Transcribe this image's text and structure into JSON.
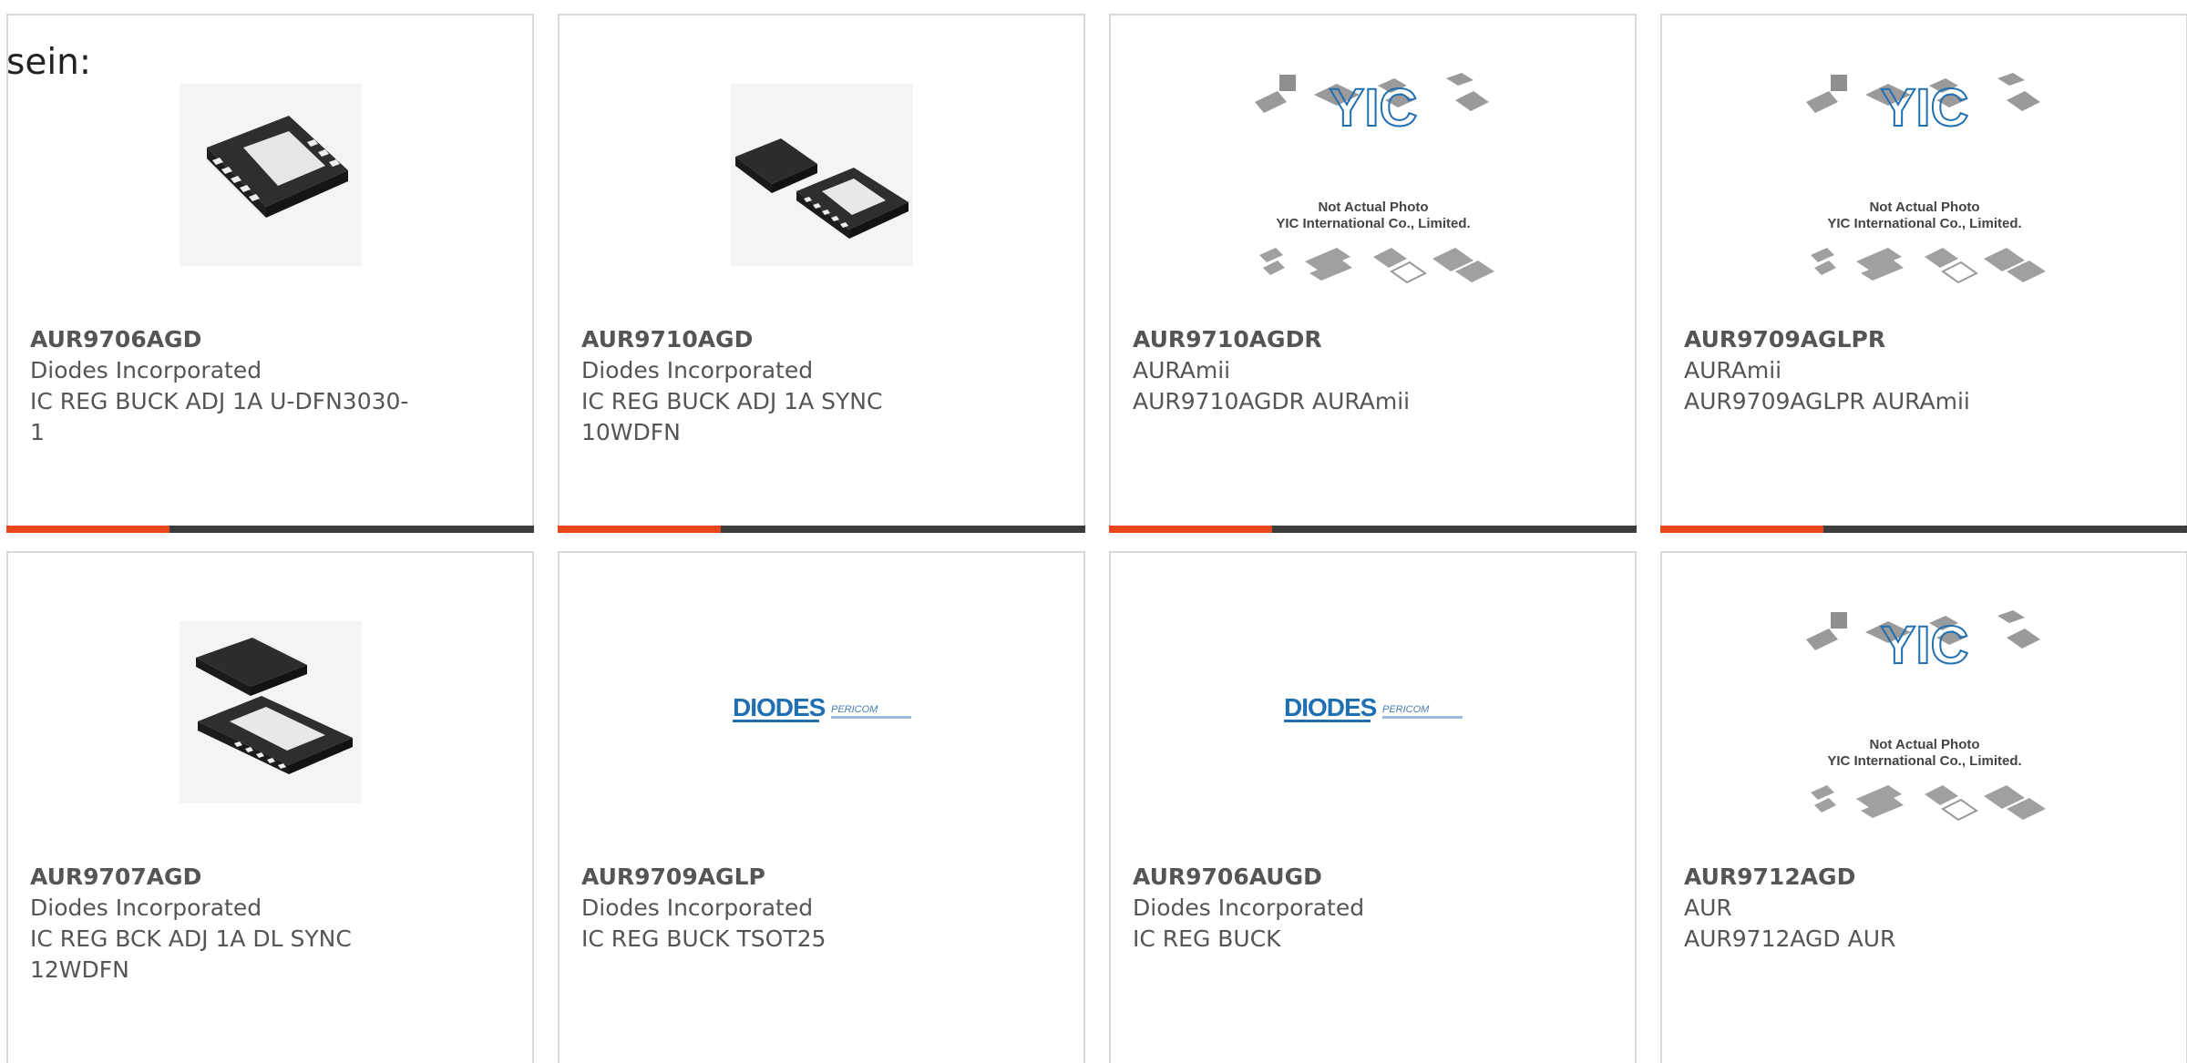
{
  "intro": {
    "text": "sein:"
  },
  "colors": {
    "accent": "#e8471b",
    "track": "#3d3d3d",
    "border": "#d9d9d9",
    "text": "#555555"
  },
  "products": [
    {
      "part_number": "AUR9706AGD",
      "manufacturer": "Diodes Incorporated",
      "description": "IC REG BUCK ADJ 1A U-DFN3030-1",
      "image": "ic-chip-image",
      "progress": 0.31
    },
    {
      "part_number": "AUR9710AGD",
      "manufacturer": "Diodes Incorporated",
      "description": "IC REG BUCK ADJ 1A SYNC 10WDFN",
      "image": "ic-chip-image",
      "progress": 0.31
    },
    {
      "part_number": "AUR9710AGDR",
      "manufacturer": "AURAmii",
      "description": "AUR9710AGDR AURAmii",
      "image": "yic-placeholder-image",
      "progress": 0.31
    },
    {
      "part_number": "AUR9709AGLPR",
      "manufacturer": "AURAmii",
      "description": "AUR9709AGLPR AURAmii",
      "image": "yic-placeholder-image",
      "progress": 0.31
    },
    {
      "part_number": "AUR9707AGD",
      "manufacturer": "Diodes Incorporated",
      "description": "IC REG BCK ADJ 1A DL SYNC 12WDFN",
      "image": "ic-chip-image"
    },
    {
      "part_number": "AUR9709AGLP",
      "manufacturer": "Diodes Incorporated",
      "description": "IC REG BUCK TSOT25",
      "image": "diodes-logo-image"
    },
    {
      "part_number": "AUR9706AUGD",
      "manufacturer": "Diodes Incorporated",
      "description": "IC REG BUCK",
      "image": "diodes-logo-image"
    },
    {
      "part_number": "AUR9712AGD",
      "manufacturer": "AUR",
      "description": "AUR9712AGD AUR",
      "image": "yic-placeholder-image"
    }
  ],
  "yic_placeholder": {
    "brand": "YIC",
    "line1": "Not Actual Photo",
    "line2": "YIC International Co., Limited."
  },
  "diodes_logo": {
    "brand": "DIODES",
    "sub": "PERICOM"
  }
}
